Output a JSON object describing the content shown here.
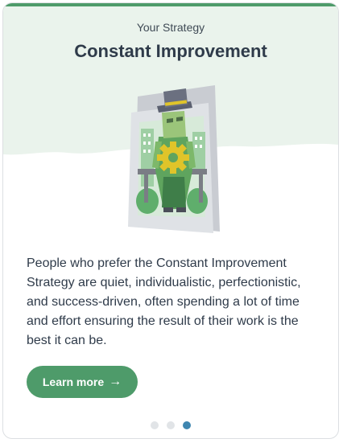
{
  "card": {
    "subtitle": "Your Strategy",
    "title": "Constant Improvement",
    "description": "People who prefer the Constant Improvement Strategy are quiet, individualistic, perfectionistic, and success-driven, often spending a lot of time and effort ensuring the result of their work is the best it can be.",
    "learn_more_label": "Learn more",
    "learn_more_icon": "arrow-right-icon",
    "illustration": "person-with-hat-and-gear-illustration"
  },
  "pagination": {
    "total": 3,
    "active_index": 2
  },
  "colors": {
    "accent_green": "#4e9b6a",
    "header_bg": "#eaf3ec",
    "text_dark": "#2f3b4a",
    "dot_active": "#3f86b0",
    "dot_inactive": "#e1e4e7"
  }
}
